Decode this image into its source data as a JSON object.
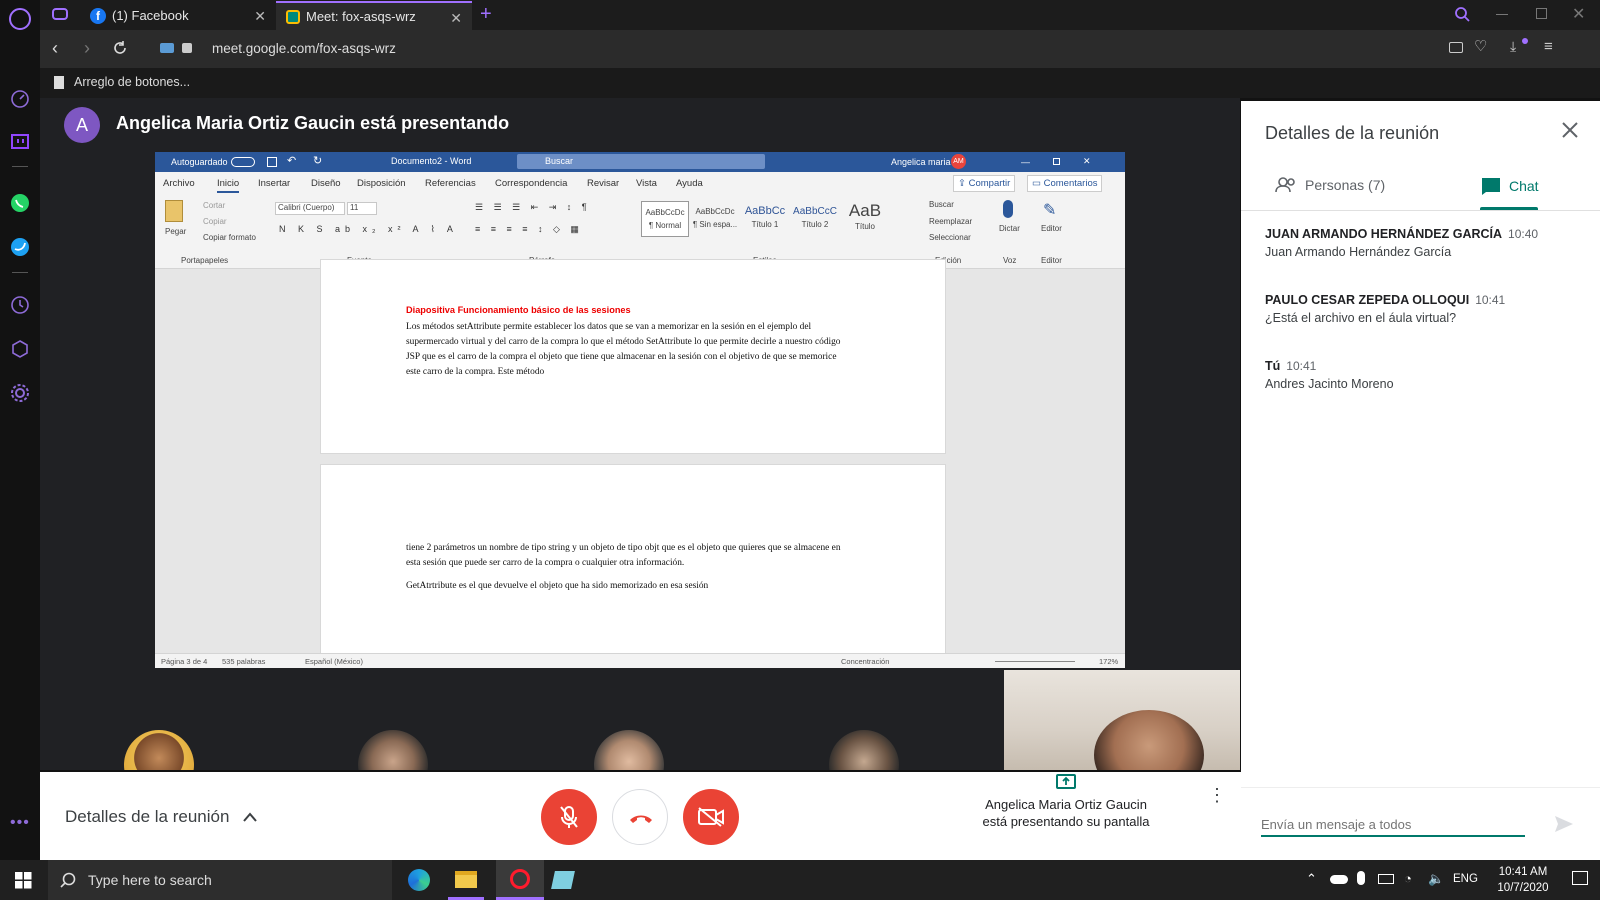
{
  "browser": {
    "tabs": [
      {
        "label": "(1) Facebook"
      },
      {
        "label": "Meet: fox-asqs-wrz"
      }
    ],
    "url": "meet.google.com/fox-asqs-wrz",
    "bookmark": "Arreglo de botones..."
  },
  "presenter": {
    "initial": "A",
    "title": "Angelica Maria Ortiz Gaucin está presentando"
  },
  "word": {
    "autosave": "Autoguardado",
    "doc_title": "Documento2 - Word",
    "search": "Buscar",
    "user": "Angelica maria",
    "user_initials": "AM",
    "tabs": [
      "Archivo",
      "Inicio",
      "Insertar",
      "Diseño",
      "Disposición",
      "Referencias",
      "Correspondencia",
      "Revisar",
      "Vista",
      "Ayuda"
    ],
    "share": "Compartir",
    "comments": "Comentarios",
    "clipboard": {
      "paste": "Pegar",
      "cut": "Cortar",
      "copy": "Copiar",
      "format": "Copiar formato",
      "group": "Portapapeles"
    },
    "font": {
      "name": "Calibri (Cuerpo)",
      "size": "11",
      "group": "Fuente"
    },
    "paragraph_group": "Párrafo",
    "styles": [
      {
        "preview": "AaBbCcDc",
        "label": "¶ Normal"
      },
      {
        "preview": "AaBbCcDc",
        "label": "¶ Sin espa..."
      },
      {
        "preview": "AaBbCc",
        "label": "Título 1"
      },
      {
        "preview": "AaBbCcC",
        "label": "Título 2"
      },
      {
        "preview": "AaB",
        "label": "Título"
      }
    ],
    "styles_group": "Estilos",
    "editing": {
      "find": "Buscar",
      "replace": "Reemplazar",
      "select": "Seleccionar",
      "group": "Edición"
    },
    "voice": {
      "label": "Dictar",
      "group": "Voz"
    },
    "editor": {
      "label": "Editor",
      "group": "Editor"
    },
    "page1": {
      "heading": "Diapositiva Funcionamiento básico de las sesiones",
      "body": "Los métodos setAttribute permite establecer los datos que se van a memorizar en la sesión en el ejemplo del supermercado virtual y del carro de la compra lo que el método SetAttribute lo que permite decirle a nuestro código JSP que es el carro de la compra el objeto que tiene que almacenar en la sesión con el objetivo de que se memorice este carro de la compra. Este método"
    },
    "page2": {
      "p1": "tiene 2 parámetros un nombre de tipo string y un objeto de tipo objt que es el objeto que quieres que se almacene en esta sesión que puede ser carro de la compra o cualquier otra información.",
      "p2": "GetAtrtribute es el que devuelve el objeto que ha sido memorizado en esa sesión"
    },
    "status": {
      "page": "Página 3 de 4",
      "words": "535 palabras",
      "lang": "Español (México)",
      "focus": "Concentración",
      "zoom": "172%"
    }
  },
  "controls": {
    "details": "Detalles de la reunión",
    "presenting_line1": "Angelica Maria Ortiz Gaucin",
    "presenting_line2": "está presentando su pantalla"
  },
  "panel": {
    "title": "Detalles de la reunión",
    "people_tab": "Personas (7)",
    "chat_tab": "Chat",
    "messages": [
      {
        "sender": "JUAN ARMANDO HERNÁNDEZ GARCÍA",
        "time": "10:40",
        "text": "Juan Armando Hernández García"
      },
      {
        "sender": "PAULO CESAR ZEPEDA OLLOQUI",
        "time": "10:41",
        "text": "¿Está el archivo en el áula virtual?"
      },
      {
        "sender": "Tú",
        "time": "10:41",
        "text": "Andres Jacinto Moreno"
      }
    ],
    "input_placeholder": "Envía un mensaje a todos"
  },
  "taskbar": {
    "search_placeholder": "Type here to search",
    "lang": "ENG",
    "time": "10:41 AM",
    "date": "10/7/2020"
  },
  "colors": {
    "opera_accent": "#a070ff",
    "meet_red": "#ea4335",
    "meet_teal": "#00796b",
    "word_blue": "#2b579a"
  }
}
